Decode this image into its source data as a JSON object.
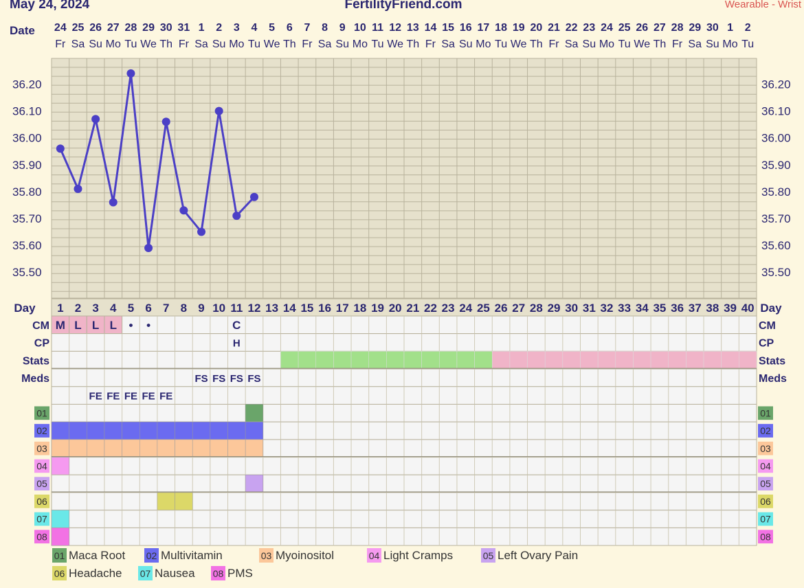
{
  "header": {
    "date": "May 24, 2024",
    "site": "FertilityFriend.com",
    "device": "Wearable - Wrist"
  },
  "colors": {
    "background": "#fdf7e0",
    "plot_area": "#e6e1cc",
    "grid": "#b8b29c",
    "line": "#4b3fc6",
    "label": "#2a2670",
    "cell": "#f5f5f5",
    "cm_fill": "#f0b4c8",
    "stats_green": "#a2e08a",
    "stats_pink": "#f0b4c8",
    "header_red": "#d9534f"
  },
  "row_labels": {
    "date": "Date",
    "day": "Day",
    "cm": "CM",
    "cp": "CP",
    "stats": "Stats",
    "meds": "Meds"
  },
  "chart_data": {
    "type": "line",
    "dates": [
      "24",
      "25",
      "26",
      "27",
      "28",
      "29",
      "30",
      "31",
      "1",
      "2",
      "3",
      "4",
      "5",
      "6",
      "7",
      "8",
      "9",
      "10",
      "11",
      "12",
      "13",
      "14",
      "15",
      "16",
      "17",
      "18",
      "19",
      "20",
      "21",
      "22",
      "23",
      "24",
      "25",
      "26",
      "27",
      "28",
      "29",
      "30",
      "1",
      "2"
    ],
    "weekdays": [
      "Fr",
      "Sa",
      "Su",
      "Mo",
      "Tu",
      "We",
      "Th",
      "Fr",
      "Sa",
      "Su",
      "Mo",
      "Tu",
      "We",
      "Th",
      "Fr",
      "Sa",
      "Su",
      "Mo",
      "Tu",
      "We",
      "Th",
      "Fr",
      "Sa",
      "Su",
      "Mo",
      "Tu",
      "We",
      "Th",
      "Fr",
      "Sa",
      "Su",
      "Mo",
      "Tu",
      "We",
      "Th",
      "Fr",
      "Sa",
      "Su",
      "Mo",
      "Tu"
    ],
    "days": [
      "1",
      "2",
      "3",
      "4",
      "5",
      "6",
      "7",
      "8",
      "9",
      "10",
      "11",
      "12",
      "13",
      "14",
      "15",
      "16",
      "17",
      "18",
      "19",
      "20",
      "21",
      "22",
      "23",
      "24",
      "25",
      "26",
      "27",
      "28",
      "29",
      "30",
      "31",
      "32",
      "33",
      "34",
      "35",
      "36",
      "37",
      "38",
      "39",
      "40"
    ],
    "y_ticks": [
      "36.20",
      "36.10",
      "36.00",
      "35.90",
      "35.80",
      "35.70",
      "35.60",
      "35.50"
    ],
    "ylim": [
      35.4,
      36.3
    ],
    "series": [
      {
        "values": [
          35.96,
          35.81,
          36.07,
          35.76,
          36.24,
          35.59,
          36.06,
          35.73,
          35.65,
          36.1,
          35.71,
          35.78
        ]
      }
    ],
    "cm": [
      {
        "day": 1,
        "text": "M",
        "fill": true
      },
      {
        "day": 2,
        "text": "L",
        "fill": true
      },
      {
        "day": 3,
        "text": "L",
        "fill": true
      },
      {
        "day": 4,
        "text": "L",
        "fill": true
      },
      {
        "day": 5,
        "text": "•",
        "fill": false
      },
      {
        "day": 6,
        "text": "•",
        "fill": false
      },
      {
        "day": 11,
        "text": "C",
        "fill": false
      }
    ],
    "cp": [
      {
        "day": 11,
        "text": "H"
      }
    ],
    "stats": [
      {
        "from": 14,
        "to": 25,
        "color": "#a2e08a"
      },
      {
        "from": 26,
        "to": 40,
        "color": "#f0b4c8"
      }
    ],
    "meds_row1": [
      {
        "day": 9,
        "text": "FS"
      },
      {
        "day": 10,
        "text": "FS"
      },
      {
        "day": 11,
        "text": "FS"
      },
      {
        "day": 12,
        "text": "FS"
      }
    ],
    "meds_row2": [
      {
        "day": 3,
        "text": "FE"
      },
      {
        "day": 4,
        "text": "FE"
      },
      {
        "day": 5,
        "text": "FE"
      },
      {
        "day": 6,
        "text": "FE"
      },
      {
        "day": 7,
        "text": "FE"
      }
    ],
    "tracks": [
      {
        "code": "01",
        "color": "#6aa56a",
        "cells": [
          12
        ]
      },
      {
        "code": "02",
        "color": "#6b6bf0",
        "cells": [
          1,
          2,
          3,
          4,
          5,
          6,
          7,
          8,
          9,
          10,
          11,
          12
        ]
      },
      {
        "code": "03",
        "color": "#fcc79a",
        "cells": [
          1,
          2,
          3,
          4,
          5,
          6,
          7,
          8,
          9,
          10,
          11,
          12
        ]
      },
      {
        "code": "04",
        "color": "#f59af0",
        "cells": [
          1
        ]
      },
      {
        "code": "05",
        "color": "#c8a3f0",
        "cells": [
          12
        ]
      },
      {
        "code": "06",
        "color": "#dcd868",
        "cells": [
          7,
          8
        ]
      },
      {
        "code": "07",
        "color": "#6ae8e8",
        "cells": [
          1
        ]
      },
      {
        "code": "08",
        "color": "#f272e4",
        "cells": [
          1
        ]
      }
    ],
    "legend": [
      {
        "code": "01",
        "label": "Maca Root",
        "color": "#6aa56a"
      },
      {
        "code": "02",
        "label": "Multivitamin",
        "color": "#6b6bf0"
      },
      {
        "code": "03",
        "label": "Myoinositol",
        "color": "#fcc79a"
      },
      {
        "code": "04",
        "label": "Light Cramps",
        "color": "#f59af0"
      },
      {
        "code": "05",
        "label": "Left Ovary Pain",
        "color": "#c8a3f0"
      },
      {
        "code": "06",
        "label": "Headache",
        "color": "#dcd868"
      },
      {
        "code": "07",
        "label": "Nausea",
        "color": "#6ae8e8"
      },
      {
        "code": "08",
        "label": "PMS",
        "color": "#f272e4"
      }
    ]
  }
}
